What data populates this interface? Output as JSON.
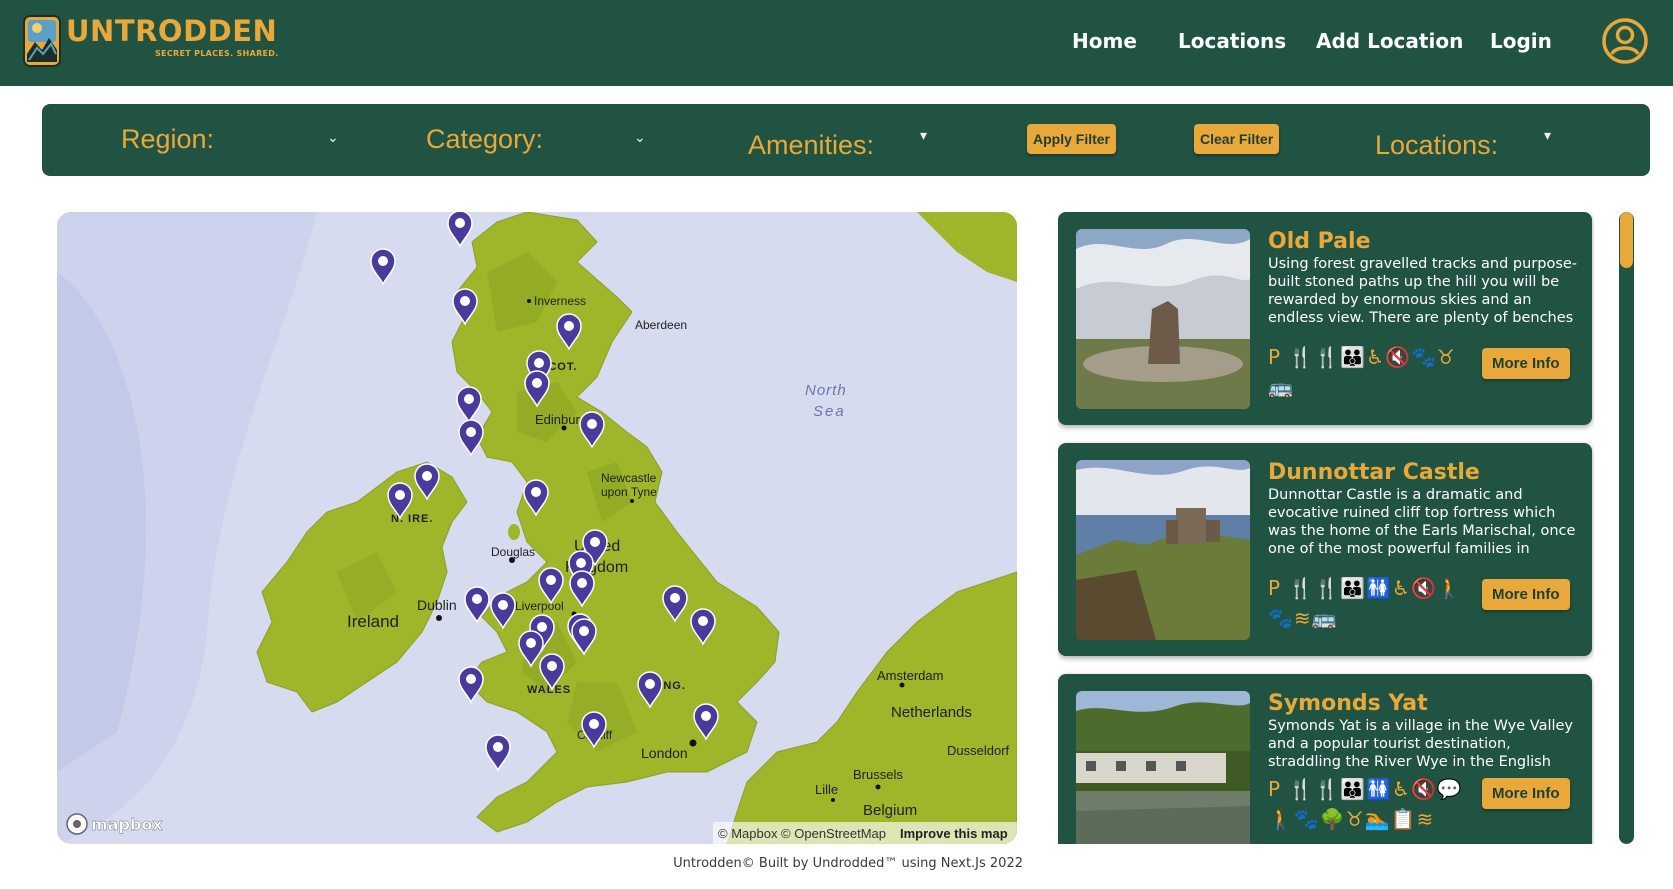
{
  "header": {
    "logo_text": "UNTRODDEN",
    "logo_tagline": "SECRET PLACES. SHARED.",
    "nav": {
      "home": "Home",
      "locations": "Locations",
      "add_location": "Add Location",
      "login": "Login"
    }
  },
  "filters": {
    "region_label": "Region:",
    "category_label": "Category:",
    "amenities_label": "Amenities:",
    "apply_label": "Apply Filter",
    "clear_label": "Clear Filter",
    "locations_label": "Locations:"
  },
  "map": {
    "labels": {
      "inverness": "Inverness",
      "aberdeen": "Aberdeen",
      "scot": "SCOT.",
      "edinburgh": "Edinburgh",
      "north_sea_1": "North",
      "north_sea_2": "Sea",
      "newcastle_1": "Newcastle",
      "newcastle_2": "upon Tyne",
      "n_ire": "N. IRE.",
      "douglas": "Douglas",
      "united_1": "United",
      "united_2": "Kingdom",
      "dublin": "Dublin",
      "ireland": "Ireland",
      "liverpool": "Liverpool",
      "wales": "WALES",
      "eng": "ENG.",
      "amsterdam": "Amsterdam",
      "netherlands": "Netherlands",
      "cardiff": "Cardiff",
      "london": "London",
      "dusseldorf": "Dusseldorf",
      "brussels": "Brussels",
      "lille": "Lille",
      "belgium": "Belgium"
    },
    "mapbox_logo": "mapbox",
    "attribution": "© Mapbox © OpenStreetMap",
    "improve": "Improve this map"
  },
  "cards": [
    {
      "title": "Old Pale",
      "description": "Using forest gravelled tracks and purpose-built stoned paths up the hill you will be rewarded by enormous skies and an endless view. There are plenty of benches along the path for a rest.",
      "icons_line1": "P 🍴🍴👪♿🔇🐾♉",
      "icons_line2": "🚌",
      "button": "More Info"
    },
    {
      "title": "Dunnottar Castle",
      "description": "Dunnottar Castle is a dramatic and evocative ruined cliff top fortress which was the home of the Earls Marischal, once one of the most powerful families in Scotland. Steeped in history, this castle is one of Scotland's best known.",
      "icons_line1": "P 🍴🍴👪🚻♿🔇🚶",
      "icons_line2": "🐾≋🚌",
      "button": "More Info"
    },
    {
      "title": "Symonds Yat",
      "description": "Symonds Yat is a village in the Wye Valley and a popular tourist destination, straddling the River Wye in the English county of Herefordshire.",
      "icons_line1": "P 🍴🍴👪🚻♿🔇💬",
      "icons_line2": "🚶🐾🌳♉🏊📋≋",
      "button": "More Info"
    }
  ],
  "footer": "Untrodden© Built by Undrodded™ using Next.Js 2022",
  "colors": {
    "primary": "#215343",
    "accent": "#e8a83a",
    "land": "#9fb52a",
    "water": "#d6dbf0",
    "pin": "#4a3a9c"
  }
}
